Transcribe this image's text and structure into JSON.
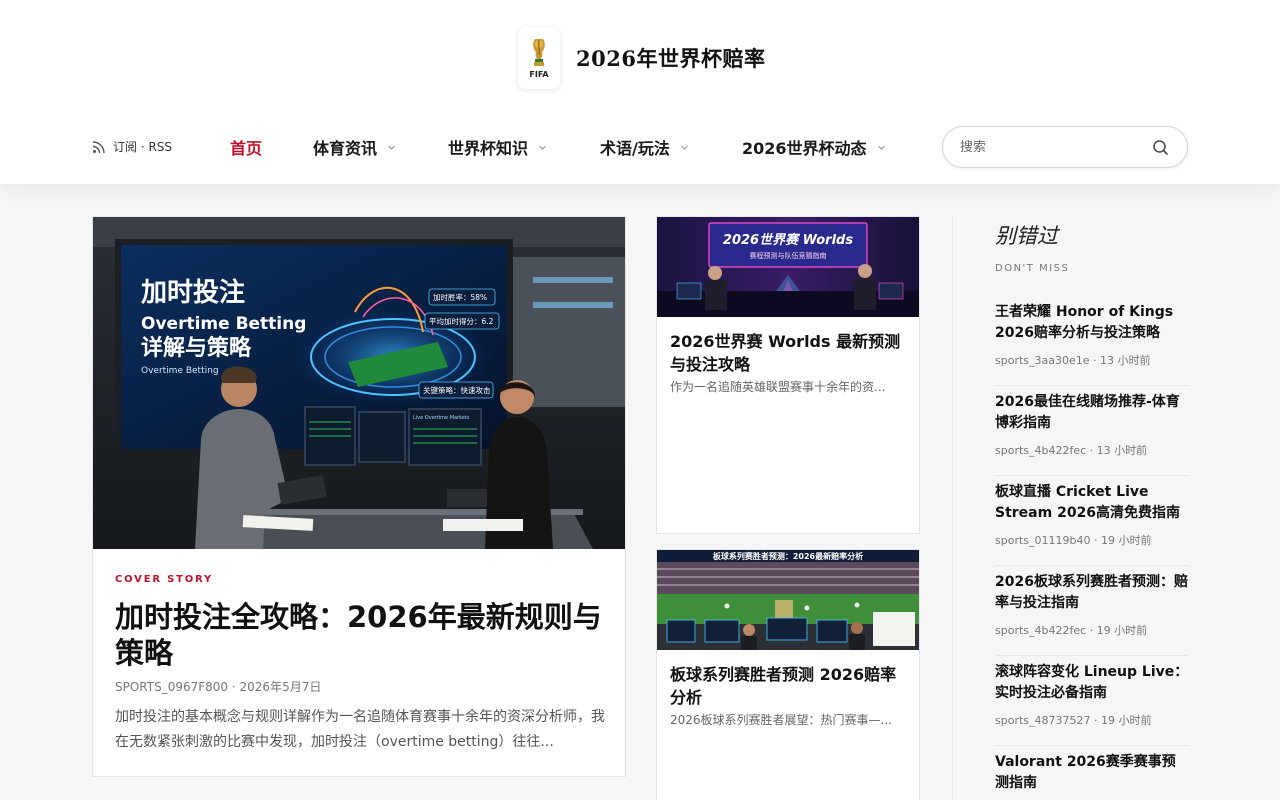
{
  "site": {
    "title": "2026年世界杯赔率",
    "logo_text": "FIFA"
  },
  "nav": {
    "rss_label": "订阅 · RSS",
    "items": [
      {
        "label": "首页"
      },
      {
        "label": "体育资讯"
      },
      {
        "label": "世界杯知识"
      },
      {
        "label": "术语/玩法"
      },
      {
        "label": "2026世界杯动态"
      }
    ],
    "search_placeholder": "搜索"
  },
  "cover": {
    "kicker": "COVER STORY",
    "title": "加时投注全攻略：2026年最新规则与策略",
    "author": "SPORTS_0967F800",
    "date": "2026年5月7日",
    "excerpt": "加时投注的基本概念与规则详解作为一名追随体育赛事十余年的资深分析师，我在无数紧张刺激的比赛中发现，加时投注（overtime betting）往往...",
    "image": {
      "headline_cn": "加时投注",
      "headline_en": "Overtime Betting",
      "headline_cn2": "详解与策略",
      "caption": "Overtime Betting",
      "stat1": "加时胜率：58%",
      "stat2": "平均加时得分：6.2",
      "stat3": "关键策略：快速攻击",
      "screen_label": "Live Overtime Markets"
    }
  },
  "cards": [
    {
      "title": "2026世界赛 Worlds 最新预测与投注攻略",
      "excerpt": "作为一名追随英雄联盟赛事十余年的资...",
      "image": {
        "headline": "2026世界赛 Worlds",
        "sub": "赛程预测与队伍竞猜指南"
      }
    },
    {
      "title": "板球系列赛胜者预测 2026赔率分析",
      "excerpt": "2026板球系列赛胜者展望：热门赛事—...",
      "image": {
        "headline": "板球系列赛胜者预测：2026最新赔率分析"
      }
    }
  ],
  "sidebar": {
    "title": "别错过",
    "subtitle": "DON'T MISS",
    "items": [
      {
        "title": "王者荣耀 Honor of Kings 2026赔率分析与投注策略",
        "meta": "sports_3aa30e1e · 13 小时前"
      },
      {
        "title": "2026最佳在线赌场推荐-体育博彩指南",
        "meta": "sports_4b422fec · 13 小时前"
      },
      {
        "title": "板球直播 Cricket Live Stream 2026高清免费指南",
        "meta": "sports_01119b40 · 19 小时前"
      },
      {
        "title": "2026板球系列赛胜者预测：赔率与投注指南",
        "meta": "sports_4b422fec · 19 小时前"
      },
      {
        "title": "滚球阵容变化 Lineup Live：实时投注必备指南",
        "meta": "sports_48737527 · 19 小时前"
      },
      {
        "title": "Valorant 2026赛季赛事预测指南",
        "meta": ""
      }
    ]
  },
  "colors": {
    "accent": "#c0122a"
  }
}
